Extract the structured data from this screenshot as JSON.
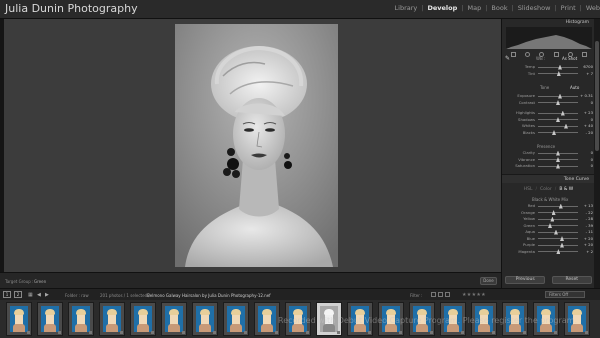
{
  "app": {
    "identity": "Julia Dunin Photography",
    "modules": [
      {
        "label": "Library",
        "active": false
      },
      {
        "label": "Develop",
        "active": true
      },
      {
        "label": "Map",
        "active": false
      },
      {
        "label": "Book",
        "active": false
      },
      {
        "label": "Slideshow",
        "active": false
      },
      {
        "label": "Print",
        "active": false
      },
      {
        "label": "Web",
        "active": false
      }
    ]
  },
  "toolbar": {
    "target_label": "Target Group :",
    "target_value": "Green",
    "button_label": "Done"
  },
  "right_panel": {
    "histogram_title": "Histogram",
    "basic": {
      "wb_label": "WB :",
      "wb_value": "As Shot",
      "treatment_label": "Treatment :",
      "tone_label": "Tone",
      "tone_auto": "Auto",
      "presence_label": "Presence",
      "sliders": [
        {
          "label": "Temp",
          "value": "6700",
          "pos": 0.55
        },
        {
          "label": "Tint",
          "value": "+ 7",
          "pos": 0.52
        },
        {
          "label": "Exposure",
          "value": "+ 0.31",
          "pos": 0.55
        },
        {
          "label": "Contrast",
          "value": "0",
          "pos": 0.5
        },
        {
          "label": "Highlights",
          "value": "+ 23",
          "pos": 0.62
        },
        {
          "label": "Shadows",
          "value": "0",
          "pos": 0.5
        },
        {
          "label": "Whites",
          "value": "+ 40",
          "pos": 0.7
        },
        {
          "label": "Blacks",
          "value": "- 20",
          "pos": 0.4
        },
        {
          "label": "Clarity",
          "value": "0",
          "pos": 0.5
        },
        {
          "label": "Vibrance",
          "value": "0",
          "pos": 0.5
        },
        {
          "label": "Saturation",
          "value": "0",
          "pos": 0.5
        }
      ]
    },
    "tone_curve_title": "Tone Curve",
    "hsl_tabs": [
      {
        "label": "HSL",
        "active": false
      },
      {
        "label": "Color",
        "active": false
      },
      {
        "label": "B & W",
        "active": true
      }
    ],
    "bw_mix_label": "Black & White Mix",
    "bw_sliders": [
      {
        "label": "Red",
        "value": "+ 13",
        "pos": 0.57
      },
      {
        "label": "Orange",
        "value": "- 22",
        "pos": 0.39
      },
      {
        "label": "Yellow",
        "value": "- 28",
        "pos": 0.36
      },
      {
        "label": "Green",
        "value": "- 39",
        "pos": 0.3
      },
      {
        "label": "Aqua",
        "value": "- 11",
        "pos": 0.45
      },
      {
        "label": "Blue",
        "value": "+ 20",
        "pos": 0.6
      },
      {
        "label": "Purple",
        "value": "+ 20",
        "pos": 0.6
      },
      {
        "label": "Magenta",
        "value": "+ 2",
        "pos": 0.51
      }
    ],
    "previous_label": "Previous",
    "reset_label": "Reset"
  },
  "filmstrip_bar": {
    "page1": "1",
    "page2": "2",
    "source": "Folder : raw",
    "count": "201 photos / 1 selected /",
    "filename": "Belmono Galway Hairsalon by Julia Dunin Photography-12.nef",
    "filter_label": "Filter :",
    "filter_select": "Filters Off"
  },
  "watermark": "Recorded with Debut Video Capture Program. Please register the program.",
  "icons": {
    "grid_icon": "grid",
    "prev_icon": "arrow-left",
    "next_icon": "arrow-right",
    "eyedropper_icon": "eyedropper"
  }
}
